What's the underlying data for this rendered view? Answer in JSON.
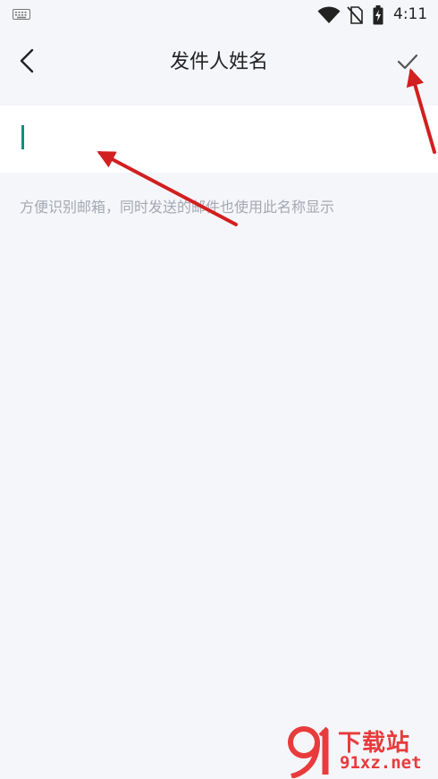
{
  "status_bar": {
    "time": "4:11",
    "icons": [
      "keyboard-icon",
      "wifi-icon",
      "no-sim-icon",
      "battery-charging-icon"
    ]
  },
  "app_bar": {
    "title": "发件人姓名",
    "back_icon": "chevron-left-icon",
    "confirm_icon": "check-icon"
  },
  "name_field": {
    "value": "",
    "placeholder": ""
  },
  "hint_text": "方便识别邮箱，同时发送的邮件也使用此名称显示",
  "colors": {
    "background": "#f5f6fa",
    "field_background": "#ffffff",
    "caret": "#138c83",
    "annotation_arrow": "#d21f1f",
    "hint_text": "#a5a8b0"
  },
  "watermark": {
    "brand": "下载站",
    "domain": "91xz.net",
    "logo_icon": "91-logo-icon"
  }
}
